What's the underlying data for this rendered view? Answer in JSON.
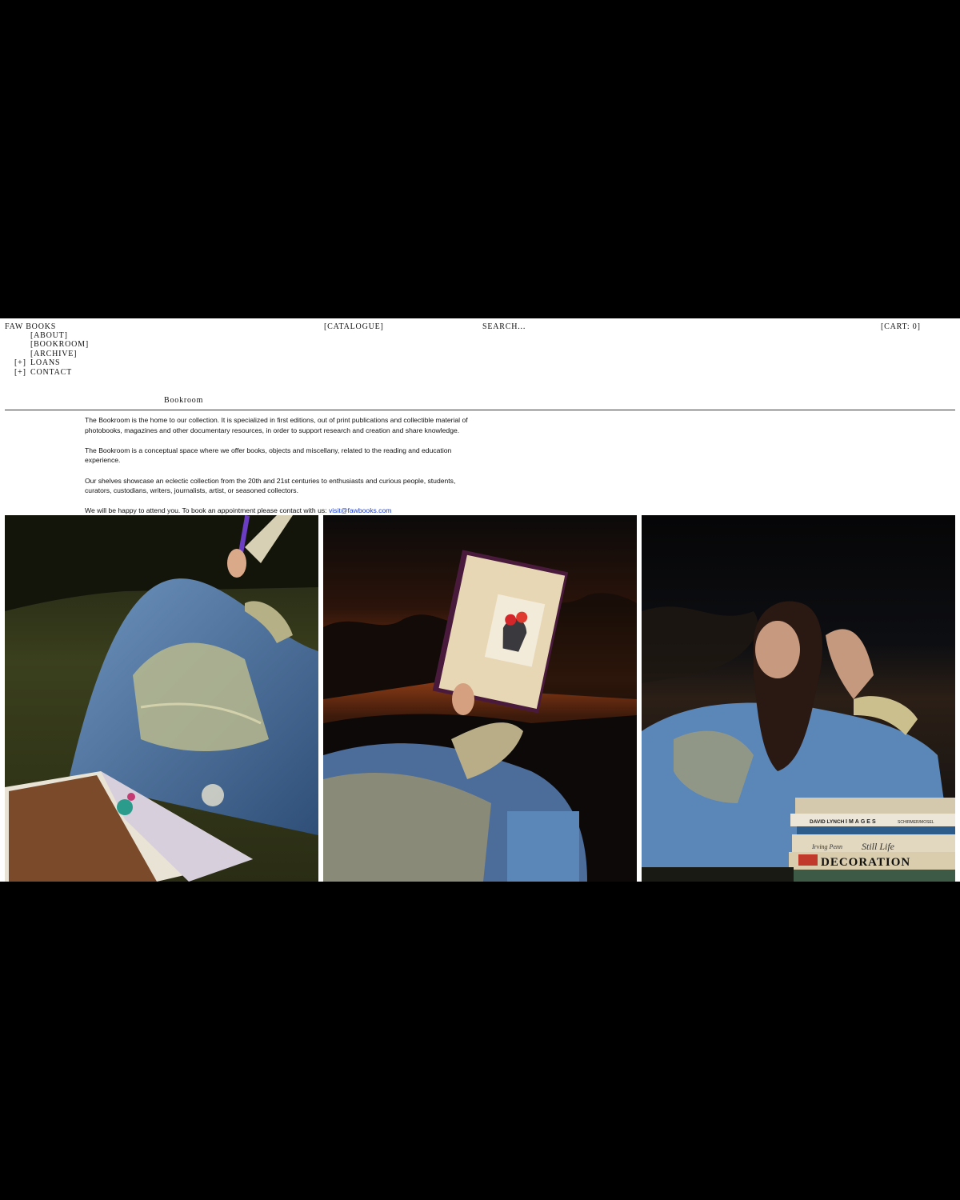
{
  "header": {
    "logo": "FAW BOOKS",
    "catalogue": "[CATALOGUE]",
    "search_placeholder": "SEARCH...",
    "cart": "[CART: 0]"
  },
  "menu": [
    {
      "prefix": "",
      "label": "[ABOUT]"
    },
    {
      "prefix": "",
      "label": "[BOOKROOM]"
    },
    {
      "prefix": "",
      "label": "[ARCHIVE]"
    },
    {
      "prefix": "[+]",
      "label": "LOANS"
    },
    {
      "prefix": "[+]",
      "label": "CONTACT"
    }
  ],
  "section": {
    "title": "Bookroom"
  },
  "content": {
    "p1": "The Bookroom is the home to our collection. It is specialized in first editions, out of print publications and collectible material of photobooks, magazines and other documentary resources, in order to support research and creation and share knowledge.",
    "p2": "The Bookroom is a conceptual space where we offer books, objects and miscellany, related to the reading and education experience.",
    "p3": "Our shelves showcase an eclectic collection from the 20th and 21st centuries to enthusiasts and curious people, students, curators, custodians, writers, journalists, artist, or seasoned collectors.",
    "p4": "We will be happy to attend you. To book an appointment please contact with us:",
    "email": "visit@fawbooks.com"
  },
  "gallery": {
    "book_spines": [
      "DAVID LYNCH",
      "IMAGES",
      "SCHIRMER/MOSEL",
      "Irving Penn",
      "Still Life",
      "DECORATION"
    ]
  }
}
